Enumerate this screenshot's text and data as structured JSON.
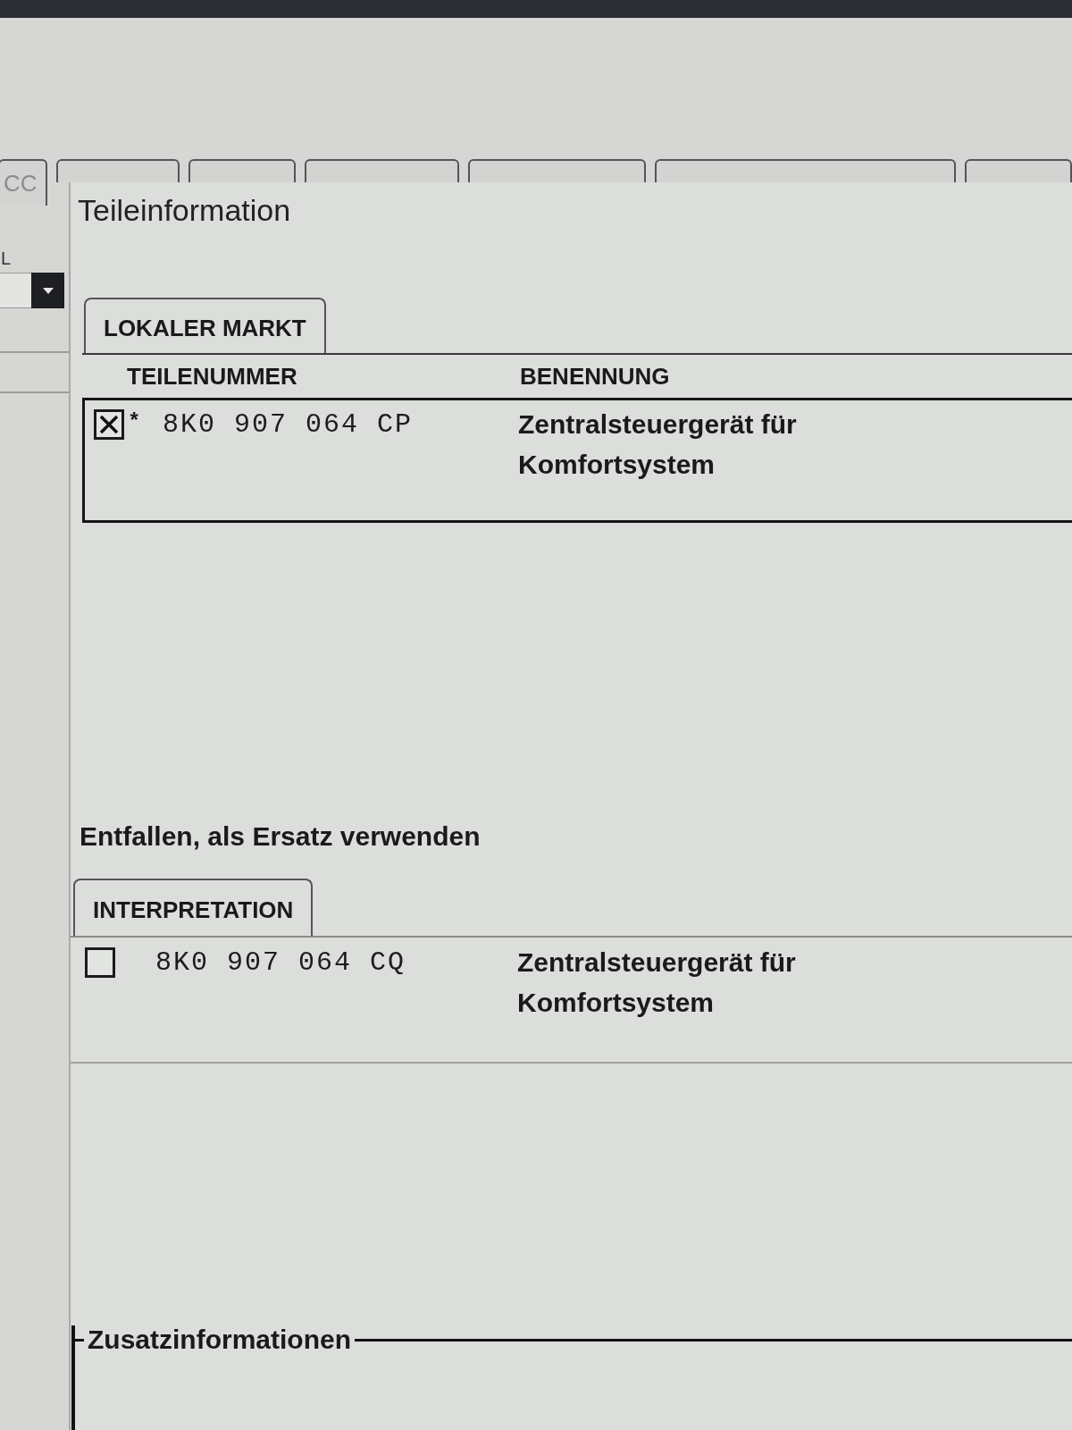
{
  "background_window": {
    "tab_label": "CC",
    "field_label": "L"
  },
  "dialog": {
    "title": "Teileinformation",
    "local_market": {
      "tab": "LOKALER MARKT",
      "columns": [
        "TEILENUMMER",
        "BENENNUNG"
      ],
      "rows": [
        {
          "checked": true,
          "marker": "*",
          "part_number": "8K0 907 064 CP",
          "description": "Zentralsteuergerät für Komfortsystem"
        }
      ]
    },
    "replacement": {
      "heading": "Entfallen, als Ersatz verwenden",
      "tab": "INTERPRETATION",
      "rows": [
        {
          "checked": false,
          "part_number": "8K0 907 064 CQ",
          "description": "Zentralsteuergerät für Komfortsystem"
        }
      ]
    },
    "additional_info": {
      "title": "Zusatzinformationen"
    }
  }
}
